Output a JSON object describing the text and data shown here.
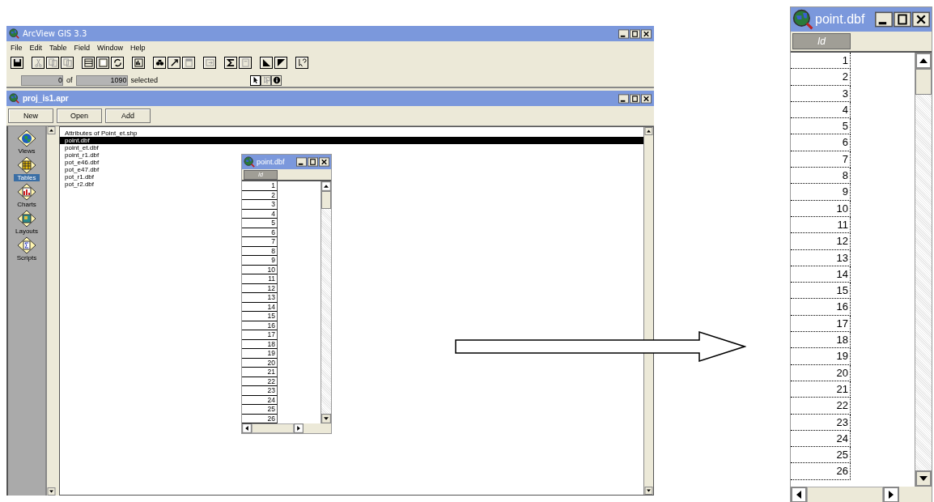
{
  "app_window": {
    "title": "ArcView GIS 3.3"
  },
  "menu": [
    "File",
    "Edit",
    "Table",
    "Field",
    "Window",
    "Help"
  ],
  "toolbar": [
    {
      "buttons": [
        {
          "kind": "save",
          "disabled": false
        }
      ]
    },
    {
      "buttons": [
        {
          "kind": "cut",
          "disabled": true
        },
        {
          "kind": "copy",
          "disabled": true
        },
        {
          "kind": "paste",
          "disabled": true
        }
      ]
    },
    {
      "buttons": [
        {
          "kind": "select-all",
          "disabled": false
        },
        {
          "kind": "select-none",
          "disabled": false
        },
        {
          "kind": "switch",
          "disabled": false
        }
      ]
    },
    {
      "buttons": [
        {
          "kind": "chart",
          "disabled": false
        }
      ]
    },
    {
      "buttons": [
        {
          "kind": "find",
          "disabled": false
        },
        {
          "kind": "query",
          "disabled": false
        },
        {
          "kind": "promote",
          "disabled": true
        }
      ]
    },
    {
      "buttons": [
        {
          "kind": "join",
          "disabled": true
        }
      ]
    },
    {
      "buttons": [
        {
          "kind": "sum",
          "disabled": false
        },
        {
          "kind": "calc",
          "disabled": true
        }
      ]
    },
    {
      "buttons": [
        {
          "kind": "sort-asc",
          "disabled": false
        },
        {
          "kind": "sort-desc",
          "disabled": false
        }
      ]
    },
    {
      "buttons": [
        {
          "kind": "help",
          "disabled": false
        }
      ]
    }
  ],
  "status_bar": {
    "selected_count": "0",
    "of_label": "of",
    "total_count": "1090",
    "selected_label": "selected"
  },
  "tools": [
    {
      "kind": "pointer",
      "selected": true
    },
    {
      "kind": "select",
      "selected": false
    },
    {
      "kind": "identify",
      "selected": false
    }
  ],
  "project_window": {
    "title": "proj_is1.apr",
    "buttons": [
      "New",
      "Open",
      "Add"
    ],
    "sidebar": [
      {
        "label": "Views",
        "kind": "views",
        "selected": false
      },
      {
        "label": "Tables",
        "kind": "tables",
        "selected": true
      },
      {
        "label": "Charts",
        "kind": "charts",
        "selected": false
      },
      {
        "label": "Layouts",
        "kind": "layouts",
        "selected": false
      },
      {
        "label": "Scripts",
        "kind": "scripts",
        "selected": false
      }
    ],
    "items": [
      {
        "label": "Attributes of Point_et.shp",
        "selected": false
      },
      {
        "label": "point.dbf",
        "selected": true
      },
      {
        "label": "point_et.dbf",
        "selected": false
      },
      {
        "label": "point_r1.dbf",
        "selected": false
      },
      {
        "label": "pot_e46.dbf",
        "selected": false
      },
      {
        "label": "pot_e47.dbf",
        "selected": false
      },
      {
        "label": "pot_r1.dbf",
        "selected": false
      },
      {
        "label": "pot_r2.dbf",
        "selected": false
      }
    ]
  },
  "table_window": {
    "title": "point.dbf",
    "column": "Id",
    "rows": [
      "1",
      "2",
      "3",
      "4",
      "5",
      "6",
      "7",
      "8",
      "9",
      "10",
      "11",
      "12",
      "13",
      "14",
      "15",
      "16",
      "17",
      "18",
      "19",
      "20",
      "21",
      "22",
      "23",
      "24",
      "25",
      "26"
    ]
  },
  "zoomed_table_window": {
    "title": "point.dbf",
    "column": "Id",
    "rows": [
      "1",
      "2",
      "3",
      "4",
      "5",
      "6",
      "7",
      "8",
      "9",
      "10",
      "11",
      "12",
      "13",
      "14",
      "15",
      "16",
      "17",
      "18",
      "19",
      "20",
      "21",
      "22",
      "23",
      "24",
      "25",
      "26"
    ]
  }
}
